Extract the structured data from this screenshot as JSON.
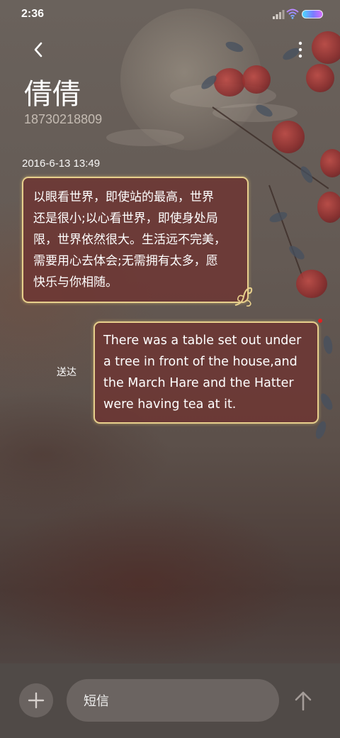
{
  "status_bar": {
    "time": "2:36",
    "signal_icon": "signal-icon",
    "wifi_icon": "wifi-icon",
    "battery_icon": "battery-icon",
    "battery_colors": [
      "#4bd8ff",
      "#7b7bff",
      "#d66cff"
    ]
  },
  "header": {
    "back_icon": "back-arrow-icon",
    "more_icon": "more-vertical-icon",
    "contact_name": "倩倩",
    "contact_number": "18730218809"
  },
  "conversation": {
    "timestamp": "2016-6-13 13:49",
    "messages": [
      {
        "direction": "incoming",
        "lines": [
          "以眼看世界，即使站的最高，世界",
          "还是很小;以心看世界，即使身处局",
          "限，世界依然很大。生活远不完美，",
          "需要用心去体会;无需拥有太多，愿",
          "快乐与你相随。"
        ]
      },
      {
        "direction": "outgoing",
        "status": "送达",
        "lines": [
          "There was a table set out under",
          "a tree in front of the house,and",
          "the March Hare and the Hatter",
          "were having tea at it."
        ]
      }
    ]
  },
  "composer": {
    "add_icon": "plus-icon",
    "placeholder": "短信",
    "send_icon": "send-arrow-icon"
  },
  "colors": {
    "bubble_fill": "#6e3432",
    "bubble_border": "#e7cf8c",
    "unread_dot": "#e02020"
  }
}
